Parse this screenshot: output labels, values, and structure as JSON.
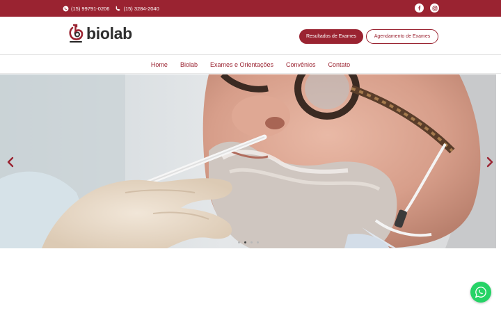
{
  "topbar": {
    "whatsapp_phone": "(15) 99791-0206",
    "landline_phone": "(15) 3284-2040",
    "social": [
      "facebook-icon",
      "instagram-icon"
    ]
  },
  "header": {
    "logo_text": "biolab",
    "results_button": "Resultados de Exames",
    "schedule_button": "Agendamento de Exames"
  },
  "nav": {
    "items": [
      {
        "label": "Home"
      },
      {
        "label": "Biolab"
      },
      {
        "label": "Exames e Orientações"
      },
      {
        "label": "Convênios"
      },
      {
        "label": "Contato"
      }
    ]
  },
  "slider": {
    "slide_count": 4,
    "active_slide": 2,
    "image": "man-nasal-swab-test-photo"
  },
  "colors": {
    "brand": "#9a2331",
    "whatsapp": "#25d366"
  }
}
